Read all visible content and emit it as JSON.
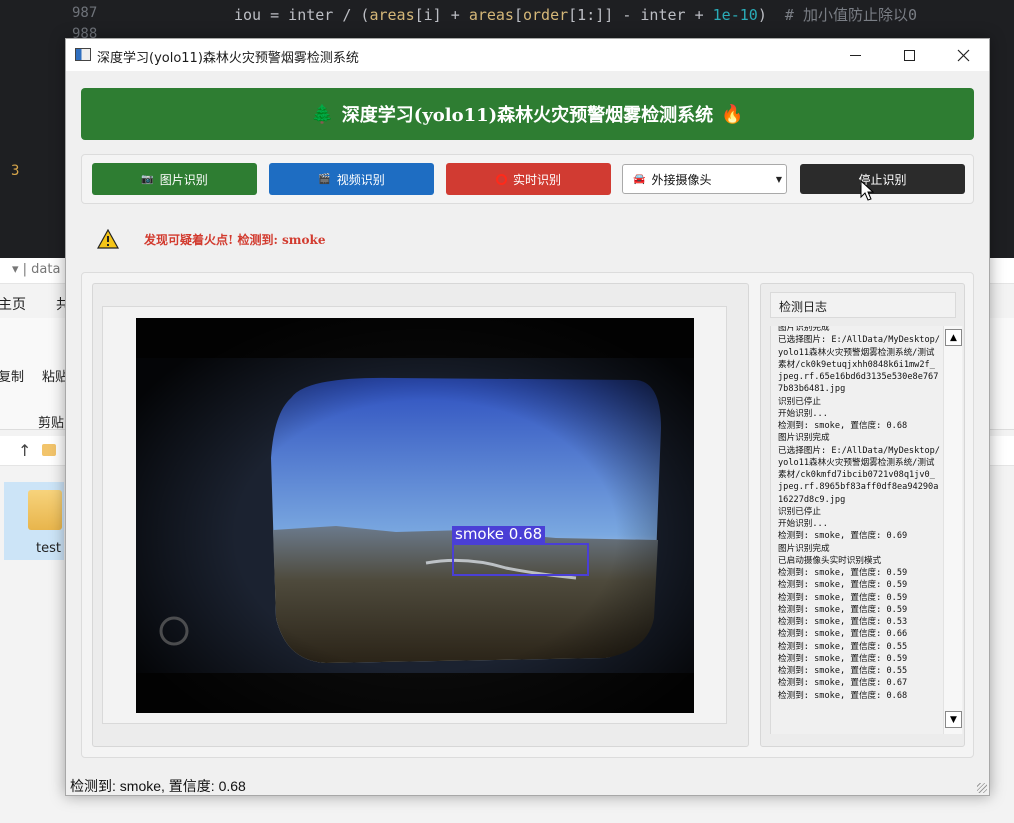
{
  "editor": {
    "line_numbers": [
      "987",
      "988",
      "3"
    ],
    "code_tokens": [
      "iou = inter / (",
      "areas",
      "[i] + ",
      "areas",
      "[",
      "order",
      "[1:]] - inter + ",
      "1e-10",
      ")  ",
      "# 加小值防止除以0"
    ]
  },
  "explorer": {
    "title": "▾ | data",
    "menu_home": "主页",
    "menu_share": "共",
    "copy": "复制",
    "paste": "粘贴",
    "clipboard": "剪贴",
    "up": "↑",
    "folder_name": "test"
  },
  "window": {
    "title": "深度学习(yolo11)森林火灾预警烟雾检测系统"
  },
  "banner": {
    "icon_left": "🌲",
    "title": "深度学习(yolo11)森林火灾预警烟雾检测系统",
    "icon_right": "🔥"
  },
  "controls": {
    "image_icon": "📷",
    "image_label": "图片识别",
    "video_icon": "🎬",
    "video_label": "视频识别",
    "realtime_label": "实时识别",
    "camera_icon": "🚘",
    "camera_value": "外接摄像头",
    "stop_label": "停止识别"
  },
  "alert": {
    "text": "发现可疑着火点! 检测到: smoke"
  },
  "detection": {
    "label": "smoke 0.68",
    "box_color": "#4a3fd6"
  },
  "log": {
    "title": "检测日志",
    "lines": [
      "图片识别完成",
      "已选择图片: E:/AllData/MyDesktop/yolo11森林火灾预警烟雾检测系统/测试素材/ck0k9etuqjxhh0848k6i1mw2f_jpeg.rf.65e16bd6d3135e530e8e7677b83b6481.jpg",
      "识别已停止",
      "开始识别...",
      "检测到: smoke, 置信度: 0.68",
      "图片识别完成",
      "已选择图片: E:/AllData/MyDesktop/yolo11森林火灾预警烟雾检测系统/测试素材/ck0kmfd7ibcib0721v08q1jv0_jpeg.rf.8965bf83aff0df8ea94290a16227d8c9.jpg",
      "识别已停止",
      "开始识别...",
      "检测到: smoke, 置信度: 0.69",
      "图片识别完成",
      "已启动摄像头实时识别模式",
      "检测到: smoke, 置信度: 0.59",
      "检测到: smoke, 置信度: 0.59",
      "检测到: smoke, 置信度: 0.59",
      "检测到: smoke, 置信度: 0.59",
      "检测到: smoke, 置信度: 0.53",
      "检测到: smoke, 置信度: 0.66",
      "检测到: smoke, 置信度: 0.55",
      "检测到: smoke, 置信度: 0.59",
      "检测到: smoke, 置信度: 0.55",
      "检测到: smoke, 置信度: 0.67",
      "检测到: smoke, 置信度: 0.68"
    ]
  },
  "status": {
    "text": "检测到: smoke, 置信度: 0.68"
  },
  "colors": {
    "banner": "#2e7d32",
    "image_button": "#2e7d32",
    "video_button": "#1e6dc2",
    "realtime_button": "#d13b32",
    "stop_button": "#2b2b2b",
    "alert_text": "#d23b2f"
  }
}
